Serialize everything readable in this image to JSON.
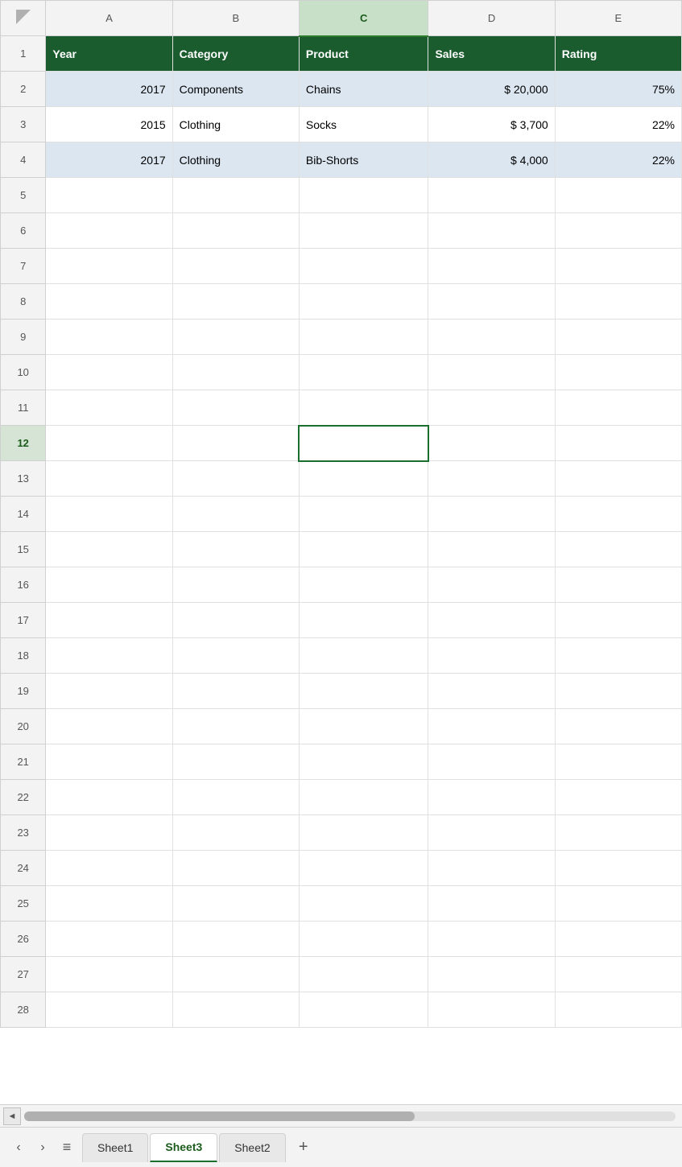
{
  "colors": {
    "header_bg": "#1a5c2e",
    "header_text": "#ffffff",
    "shaded_row": "#dce6f1",
    "active_col_header": "#c8dfc8",
    "active_row_num": "#d6e4d6",
    "selected_border": "#1a6e2e",
    "grid_line": "#e0e0e0"
  },
  "columns": [
    {
      "id": "A",
      "label": "A"
    },
    {
      "id": "B",
      "label": "B"
    },
    {
      "id": "C",
      "label": "C",
      "active": true
    },
    {
      "id": "D",
      "label": "D"
    },
    {
      "id": "E",
      "label": "E"
    }
  ],
  "header_row": {
    "year": "Year",
    "category": "Category",
    "product": "Product",
    "sales": "Sales",
    "rating": "Rating"
  },
  "data_rows": [
    {
      "row": 2,
      "year": "2017",
      "category": "Components",
      "product": "Chains",
      "sales": "$ 20,000",
      "rating": "75%",
      "shaded": true
    },
    {
      "row": 3,
      "year": "2015",
      "category": "Clothing",
      "product": "Socks",
      "sales": "$  3,700",
      "rating": "22%",
      "shaded": false
    },
    {
      "row": 4,
      "year": "2017",
      "category": "Clothing",
      "product": "Bib-Shorts",
      "sales": "$  4,000",
      "rating": "22%",
      "shaded": true
    }
  ],
  "empty_rows": [
    5,
    6,
    7,
    8,
    9,
    10,
    11,
    12,
    13,
    14,
    15,
    16,
    17,
    18,
    19,
    20,
    21,
    22,
    23,
    24,
    25,
    26,
    27,
    28
  ],
  "active_cell": {
    "row": 12,
    "col": "C"
  },
  "sheets": [
    {
      "id": "sheet1",
      "label": "Sheet1",
      "active": false
    },
    {
      "id": "sheet3",
      "label": "Sheet3",
      "active": true
    },
    {
      "id": "sheet2",
      "label": "Sheet2",
      "active": false
    }
  ],
  "scroll": {
    "left_arrow": "◄"
  }
}
